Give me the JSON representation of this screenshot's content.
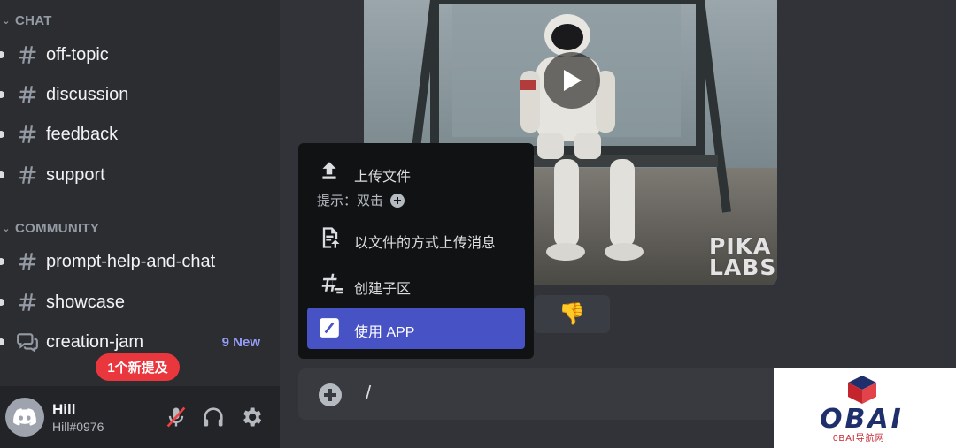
{
  "sidebar": {
    "categories": [
      {
        "label": "CHAT"
      },
      {
        "label": "COMMUNITY"
      }
    ],
    "channels": [
      {
        "name": "off-topic",
        "icon": "text-channel-icon"
      },
      {
        "name": "discussion",
        "icon": "text-channel-icon"
      },
      {
        "name": "feedback",
        "icon": "text-channel-icon"
      },
      {
        "name": "support",
        "icon": "text-channel-icon"
      },
      {
        "name": "prompt-help-and-chat",
        "icon": "text-channel-icon"
      },
      {
        "name": "showcase",
        "icon": "text-channel-icon"
      },
      {
        "name": "creation-jam",
        "icon": "forum-channel-icon",
        "badge": "9 New"
      }
    ],
    "mention_pill": "1个新提及"
  },
  "user": {
    "name": "Hill",
    "tag": "Hill#0976"
  },
  "media": {
    "watermark_text_line1": "PIKA",
    "watermark_text_line2": "LABS"
  },
  "reaction": {
    "emoji": "👎"
  },
  "popup": {
    "items": [
      {
        "label": "上传文件",
        "icon": "upload-icon"
      },
      {
        "label": "以文件的方式上传消息",
        "icon": "file-upload-icon"
      },
      {
        "label": "创建子区",
        "icon": "thread-icon"
      },
      {
        "label": "使用 APP",
        "icon": "slash-command-icon"
      }
    ],
    "hint": "提示：双击"
  },
  "composer": {
    "value": "/"
  },
  "brand": {
    "logo_text": "OBAI",
    "logo_sub": "0BAI导航网"
  },
  "colors": {
    "accent": "#4752c4",
    "mention": "#e9373d",
    "new_badge": "#949cf7"
  }
}
